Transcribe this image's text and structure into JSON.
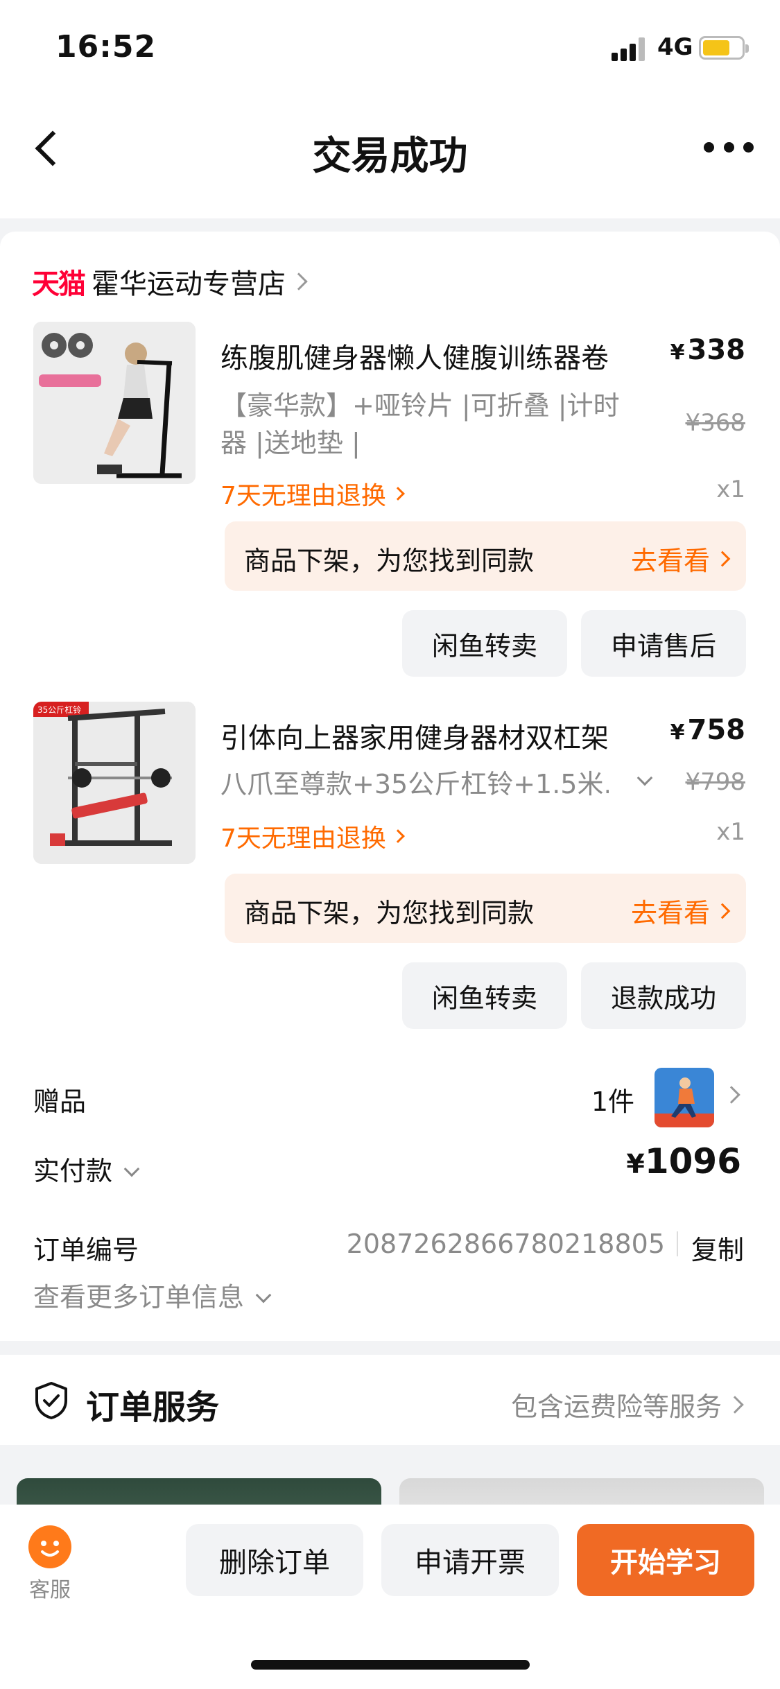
{
  "status": {
    "time": "16:52",
    "network": "4G"
  },
  "nav": {
    "title": "交易成功"
  },
  "store": {
    "platform": "天猫",
    "name": "霍华运动专营店"
  },
  "items": [
    {
      "title": "练腹肌健身器懒人健腹训练器卷",
      "spec": "【豪华款】+哑铃片 |可折叠 |计时器 |送地垫 |",
      "price_symbol": "¥",
      "price": "338",
      "original_price": "¥368",
      "qty": "x1",
      "policy": "7天无理由退换",
      "similar_text": "商品下架，为您找到同款",
      "similar_action": "去看看",
      "buttons": [
        "闲鱼转卖",
        "申请售后"
      ]
    },
    {
      "title": "引体向上器家用健身器材双杠架",
      "spec": "八爪至尊款+35公斤杠铃+1.5米...",
      "price_symbol": "¥",
      "price": "758",
      "original_price": "¥798",
      "qty": "x1",
      "policy": "7天无理由退换",
      "similar_text": "商品下架，为您找到同款",
      "similar_action": "去看看",
      "buttons": [
        "闲鱼转卖",
        "退款成功"
      ],
      "image_tag": "35公斤杠铃"
    }
  ],
  "gift": {
    "label": "赠品",
    "count": "1件"
  },
  "payment": {
    "label": "实付款",
    "symbol": "¥",
    "amount": "1096"
  },
  "order": {
    "label": "订单编号",
    "number": "2087262866780218805",
    "copy": "复制",
    "more": "查看更多订单信息"
  },
  "service": {
    "title": "订单服务",
    "desc": "包含运费险等服务"
  },
  "bottom": {
    "kefu": "客服",
    "delete": "删除订单",
    "invoice": "申请开票",
    "primary": "开始学习"
  },
  "colors": {
    "accent": "#ff6a00",
    "tmall": "#ff0036",
    "primary_button": "#f06a24"
  }
}
